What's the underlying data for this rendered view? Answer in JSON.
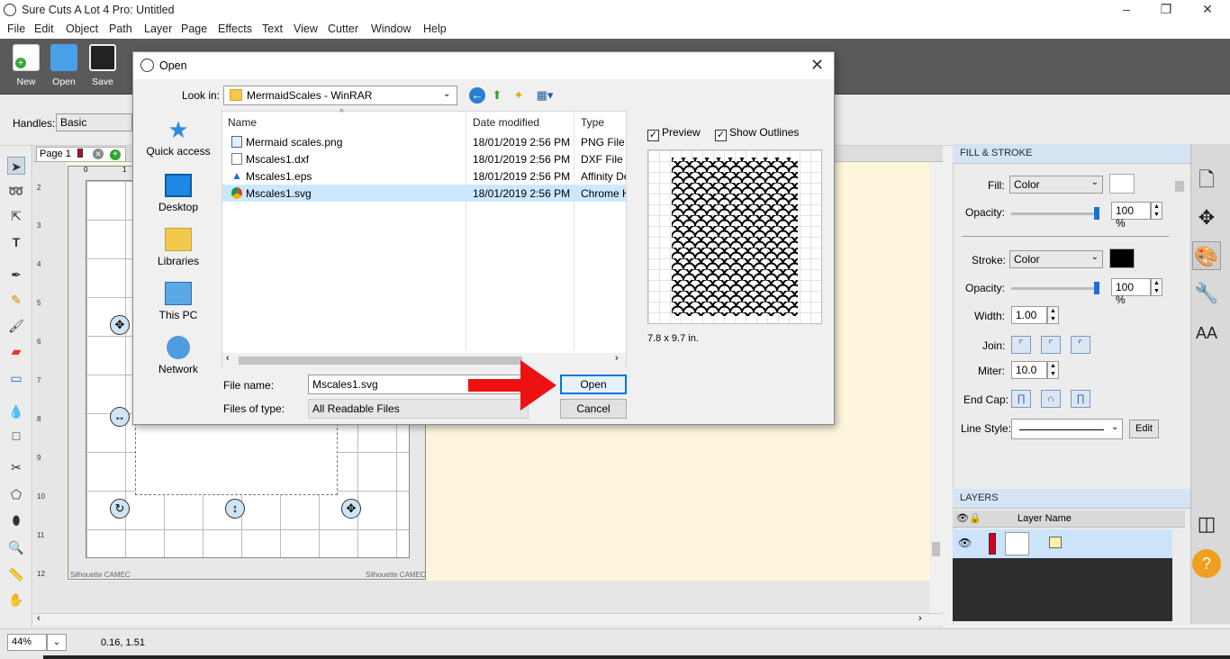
{
  "window": {
    "title": "Sure Cuts A Lot 4 Pro: Untitled",
    "minimize_glyph": "–",
    "restore_glyph": "❐",
    "close_glyph": "✕"
  },
  "menu": [
    "File",
    "Edit",
    "Object",
    "Path",
    "Layer",
    "Page",
    "Effects",
    "Text",
    "View",
    "Cutter",
    "Window",
    "Help"
  ],
  "toolbar": {
    "new_label": "New",
    "open_label": "Open",
    "save_label": "Save"
  },
  "handles": {
    "label": "Handles:",
    "value": "Basic"
  },
  "page_tab": {
    "label": "Page 1"
  },
  "ruler": {
    "left_numbers": [
      "2",
      "3",
      "4",
      "5",
      "6",
      "7",
      "8",
      "9",
      "10",
      "11",
      "12"
    ],
    "top_start": "0",
    "top_next": "1"
  },
  "mat": {
    "brand_left": "Silhouette CAMEC",
    "brand_right": "Silhouette CAMEC"
  },
  "status": {
    "zoom": "44%",
    "coords": "0.16, 1.51"
  },
  "fill_stroke": {
    "header": "FILL & STROKE",
    "fill_label": "Fill:",
    "fill_type": "Color",
    "fill_color": "#ffffff",
    "fill_opacity_label": "Opacity:",
    "fill_opacity": "100 %",
    "fill_opacity_level": 1.0,
    "stroke_label": "Stroke:",
    "stroke_type": "Color",
    "stroke_color": "#000000",
    "stroke_opacity_label": "Opacity:",
    "stroke_opacity": "100 %",
    "stroke_opacity_level": 1.0,
    "width_label": "Width:",
    "width": "1.00",
    "join_label": "Join:",
    "miter_label": "Miter:",
    "miter": "10.0",
    "endcap_label": "End Cap:",
    "linestyle_label": "Line Style:",
    "edit_label": "Edit"
  },
  "layers": {
    "header": "LAYERS",
    "column_name": "Layer Name",
    "layer_color": "#d0021b"
  },
  "dialog": {
    "title": "Open",
    "look_in_label": "Look in:",
    "look_in_value": "MermaidScales - WinRAR",
    "places": [
      "Quick access",
      "Desktop",
      "Libraries",
      "This PC",
      "Network"
    ],
    "columns": {
      "name": "Name",
      "date": "Date modified",
      "type": "Type"
    },
    "files": [
      {
        "name": "Mermaid scales.png",
        "date": "18/01/2019 2:56 PM",
        "type": "PNG File",
        "icon": "image-file-icon"
      },
      {
        "name": "Mscales1.dxf",
        "date": "18/01/2019 2:56 PM",
        "type": "DXF File",
        "icon": "document-file-icon"
      },
      {
        "name": "Mscales1.eps",
        "date": "18/01/2019 2:56 PM",
        "type": "Affinity De",
        "icon": "affinity-file-icon"
      },
      {
        "name": "Mscales1.svg",
        "date": "18/01/2019 2:56 PM",
        "type": "Chrome H",
        "icon": "chrome-file-icon"
      }
    ],
    "preview_label": "Preview",
    "show_outlines_label": "Show Outlines",
    "preview_dims": "7.8 x 9.7 in.",
    "file_name_label": "File name:",
    "file_name_value": "Mscales1.svg",
    "files_of_type_label": "Files of type:",
    "files_of_type_value": "All Readable Files",
    "open_label": "Open",
    "cancel_label": "Cancel"
  },
  "colors": {
    "accent": "#0078d7",
    "arrow": "#ee1111",
    "workspace": "#fdf6dc",
    "selection": "#cce8ff"
  }
}
